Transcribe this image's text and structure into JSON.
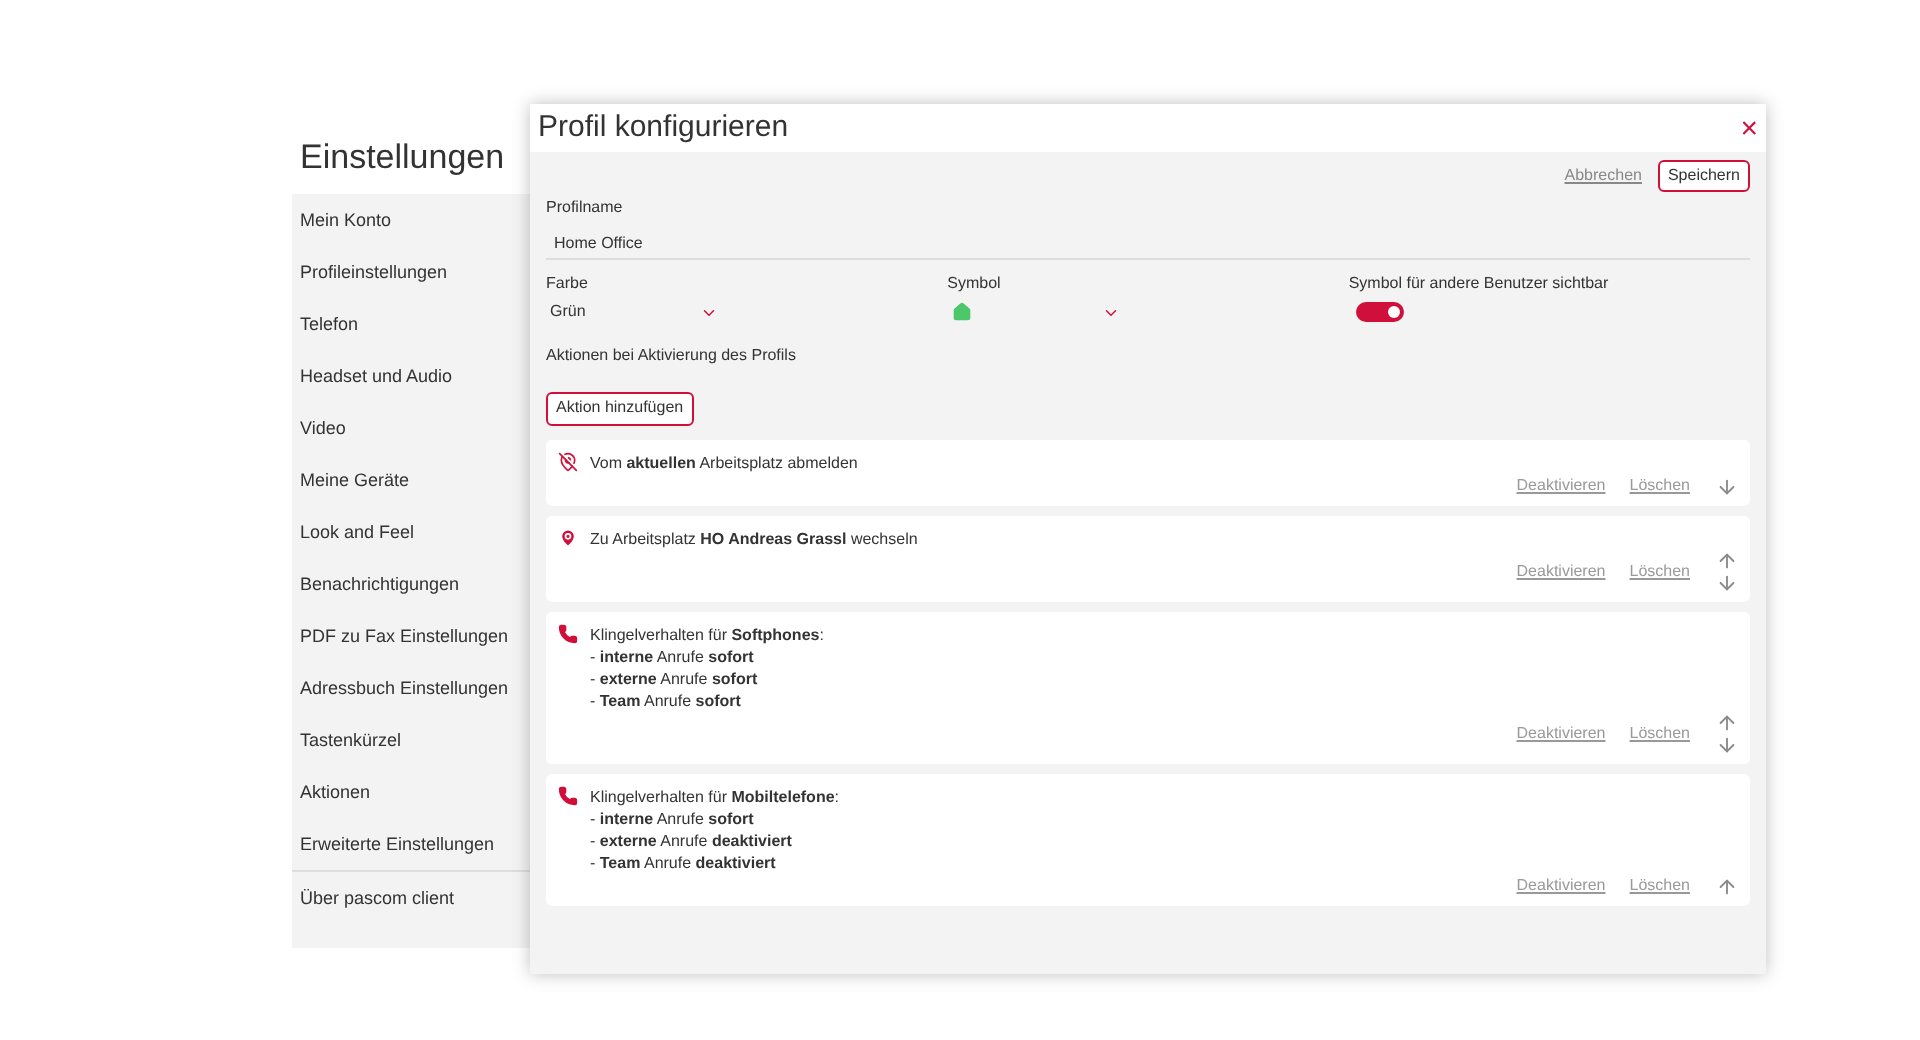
{
  "settings": {
    "title": "Einstellungen",
    "items": [
      {
        "label": "Mein Konto"
      },
      {
        "label": "Profileinstellungen"
      },
      {
        "label": "Telefon"
      },
      {
        "label": "Headset und Audio"
      },
      {
        "label": "Video"
      },
      {
        "label": "Meine Geräte"
      },
      {
        "label": "Look and Feel"
      },
      {
        "label": "Benachrichtigungen"
      },
      {
        "label": "PDF zu Fax Einstellungen"
      },
      {
        "label": "Adressbuch Einstellungen"
      },
      {
        "label": "Tastenkürzel"
      },
      {
        "label": "Aktionen"
      },
      {
        "label": "Erweiterte Einstellungen"
      }
    ],
    "footer_items": [
      {
        "label": "Über pascom client"
      }
    ]
  },
  "dialog": {
    "title": "Profil konfigurieren",
    "close": "×",
    "cancel": "Abbrechen",
    "save": "Speichern",
    "name_label": "Profilname",
    "name_value": "Home Office",
    "color_label": "Farbe",
    "color_value": "Grün",
    "symbol_label": "Symbol",
    "visible_label": "Symbol für andere Benutzer sichtbar",
    "visible_on": true,
    "actions_label": "Aktionen bei Aktivierung des Profils",
    "add_action": "Aktion hinzufügen",
    "actions": [
      {
        "kind": "logout",
        "lines": [
          "Vom **aktuellen** Arbeitsplatz abmelden"
        ],
        "deactivate": "Deaktivieren",
        "delete": "Löschen",
        "move_up": false,
        "move_down": true
      },
      {
        "kind": "location",
        "lines": [
          "Zu Arbeitsplatz **HO Andreas Grassl** wechseln"
        ],
        "deactivate": "Deaktivieren",
        "delete": "Löschen",
        "move_up": true,
        "move_down": true
      },
      {
        "kind": "phone",
        "lines": [
          "Klingelverhalten für **Softphones**:",
          "- **interne** Anrufe **sofort**",
          "- **externe** Anrufe **sofort**",
          "- **Team** Anrufe **sofort**"
        ],
        "deactivate": "Deaktivieren",
        "delete": "Löschen",
        "move_up": true,
        "move_down": true
      },
      {
        "kind": "phone",
        "lines": [
          "Klingelverhalten für **Mobiltelefone**:",
          "- **interne** Anrufe **sofort**",
          "- **externe** Anrufe **deaktiviert**",
          "- **Team** Anrufe **deaktiviert**"
        ],
        "deactivate": "Deaktivieren",
        "delete": "Löschen",
        "move_up": true,
        "move_down": false
      }
    ]
  }
}
